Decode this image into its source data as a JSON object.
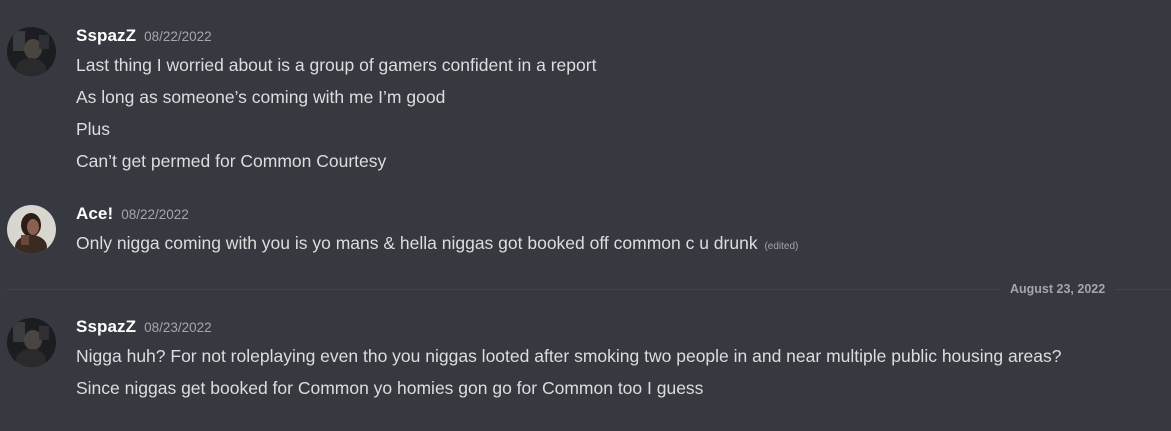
{
  "messages": [
    {
      "author": "SspazZ",
      "timestamp": "08/22/2022",
      "lines": [
        "Last thing I worried about is a group of gamers confident in a report",
        "As long as someone’s coming with me I’m good",
        "Plus",
        "Can’t get permed for Common Courtesy"
      ]
    },
    {
      "author": "Ace!",
      "timestamp": "08/22/2022",
      "lines": [
        "Only nigga coming with you is yo mans & hella niggas got booked off common c u drunk"
      ],
      "edited_label": "(edited)"
    },
    {
      "author": "SspazZ",
      "timestamp": "08/23/2022",
      "lines": [
        "Nigga huh? For not roleplaying even tho you niggas looted after smoking two people in and near multiple public housing areas?",
        "Since niggas get booked for Common yo homies gon go for Common too I guess"
      ]
    }
  ],
  "date_divider": "August 23, 2022",
  "colors": {
    "background": "#36393f",
    "username": "#ffffff",
    "message_text": "#dcddde",
    "muted": "#a3a6aa",
    "divider": "#42454a"
  }
}
